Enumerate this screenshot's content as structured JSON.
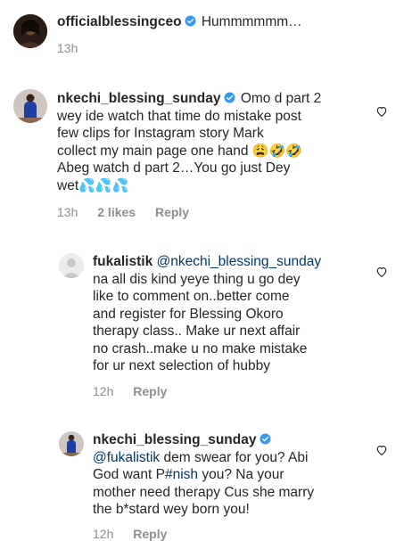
{
  "colors": {
    "text": "#262626",
    "secondary": "#8e8e8e",
    "mention": "#00376b",
    "verified": "#3897f0"
  },
  "comments": [
    {
      "username": "officialblessingceo",
      "verified": true,
      "text": "Hummmmmm…",
      "time": "13h"
    },
    {
      "username": "nkechi_blessing_sunday",
      "verified": true,
      "text_lines": [
        "Omo d part 2",
        "wey ide watch that time do mistake post",
        "few clips for Instagram story Mark",
        "collect my main page one hand",
        "Abeg watch d part 2…You go just Dey",
        "wet"
      ],
      "emoji_line4": "😩🤣🤣",
      "emoji_line6": "💦💦💦",
      "time": "13h",
      "likes": "2 likes",
      "reply": "Reply",
      "replies": [
        {
          "username": "fukalistik",
          "mention": "@nkechi_blessing_sunday",
          "text_lines": [
            "na all dis kind yeye thing u go dey",
            "like to comment on..better come",
            "and register for Blessing Okoro",
            "therapy class.. Make ur next affair",
            "no crash..make u no make mistake",
            "for ur next selection of hubby"
          ],
          "time": "12h",
          "reply": "Reply"
        },
        {
          "username": "nkechi_blessing_sunday",
          "verified": true,
          "mention": "@fukalistik",
          "text_lines": [
            "dem swear for you? Abi",
            "God want P",
            "you? Na your",
            "mother need therapy Cus she marry",
            "the b*stard wey born you!"
          ],
          "hashtag": "#nish",
          "time": "12h",
          "reply": "Reply"
        }
      ]
    }
  ]
}
